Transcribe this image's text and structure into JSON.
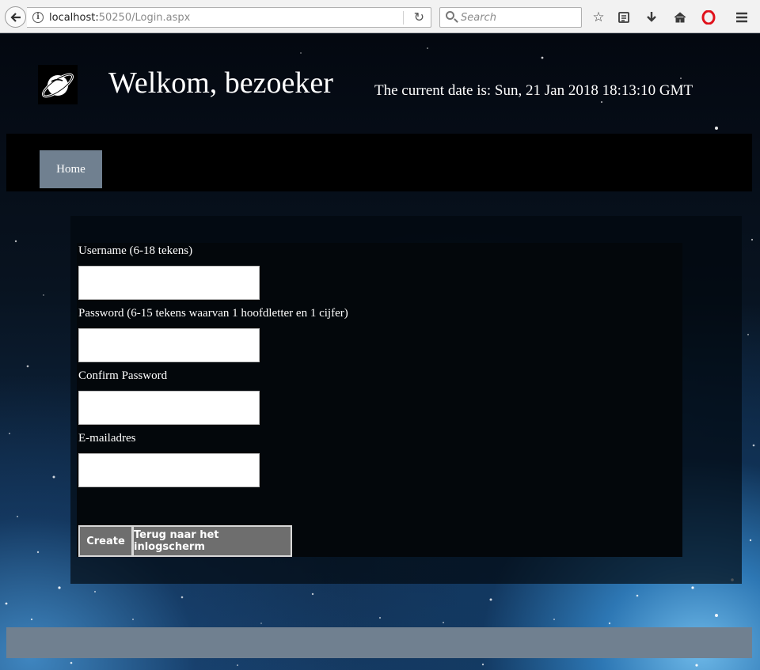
{
  "browser": {
    "url_host": "localhost:",
    "url_port": "50250",
    "url_path": "/Login.aspx",
    "search_placeholder": "Search"
  },
  "header": {
    "title": "Welkom, bezoeker",
    "date_text": "The current date is: Sun, 21 Jan 2018 18:13:10 GMT"
  },
  "nav": {
    "items": [
      {
        "label": "Home"
      }
    ]
  },
  "form": {
    "username_label": "Username (6-18 tekens)",
    "password_label": "Password (6-15 tekens waarvan 1 hoofdletter en 1 cijfer)",
    "confirm_label": "Confirm Password",
    "email_label": "E-mailadres",
    "username_value": "",
    "password_value": "",
    "confirm_value": "",
    "email_value": "",
    "create_label": "Create",
    "back_label": "Terug naar het inlogscherm"
  },
  "colors": {
    "nav_button": "#708090",
    "footer_bar": "#708090",
    "form_button": "#6e6e6e"
  }
}
